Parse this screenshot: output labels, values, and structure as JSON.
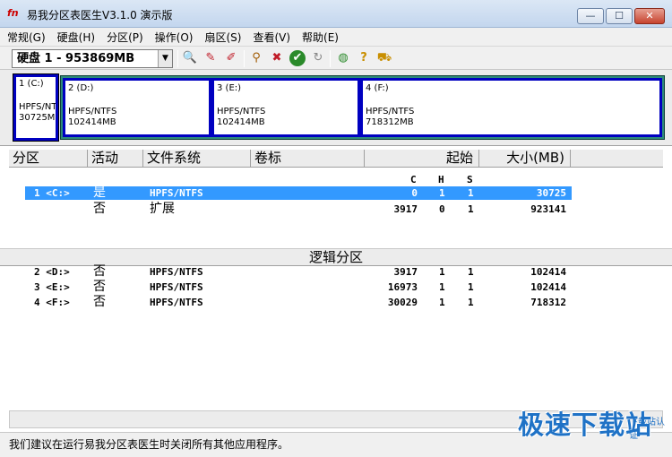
{
  "window": {
    "title": "易我分区表医生V3.1.0 演示版",
    "icon_text": "fn",
    "minimize": "—",
    "maximize": "☐",
    "close": "✕"
  },
  "menu": [
    "常规(G)",
    "硬盘(H)",
    "分区(P)",
    "操作(O)",
    "扇区(S)",
    "查看(V)",
    "帮助(E)"
  ],
  "toolbar": {
    "disk_select": "硬盘 1 - 953869MB",
    "icons": [
      "search-disk-icon",
      "write-icon",
      "write-alt-icon",
      "wand-icon",
      "clear-icon",
      "check-icon",
      "refresh-icon",
      "globe-icon",
      "help-icon",
      "cart-icon"
    ]
  },
  "partitions": {
    "c": {
      "label": "1 (C:)",
      "fs": "HPFS/NTF",
      "size": "30725MB"
    },
    "d": {
      "label": "2 (D:)",
      "fs": "HPFS/NTFS",
      "size": "102414MB"
    },
    "e": {
      "label": "3 (E:)",
      "fs": "HPFS/NTFS",
      "size": "102414MB"
    },
    "f": {
      "label": "4 (F:)",
      "fs": "HPFS/NTFS",
      "size": "718312MB"
    }
  },
  "table": {
    "headers": {
      "partition": "分区",
      "active": "活动",
      "filesystem": "文件系统",
      "volume": "卷标",
      "start": "起始",
      "size": "大小(MB)"
    },
    "sub": {
      "c": "C",
      "h": "H",
      "s": "S"
    },
    "primary_rows": [
      {
        "part": "1 <C:>",
        "active": "是",
        "fs": "HPFS/NTFS",
        "c": "0",
        "h": "1",
        "s": "1",
        "size": "30725"
      },
      {
        "part": "",
        "active": "否",
        "fs": "扩展",
        "c": "3917",
        "h": "0",
        "s": "1",
        "size": "923141"
      }
    ],
    "logical_label": "逻辑分区",
    "logical_rows": [
      {
        "part": "2 <D:>",
        "active": "否",
        "fs": "HPFS/NTFS",
        "c": "3917",
        "h": "1",
        "s": "1",
        "size": "102414"
      },
      {
        "part": "3 <E:>",
        "active": "否",
        "fs": "HPFS/NTFS",
        "c": "16973",
        "h": "1",
        "s": "1",
        "size": "102414"
      },
      {
        "part": "4 <F:>",
        "active": "否",
        "fs": "HPFS/NTFS",
        "c": "30029",
        "h": "1",
        "s": "1",
        "size": "718312"
      }
    ]
  },
  "status": {
    "text": "我们建议在运行易我分区表医生时关闭所有其他应用程序。"
  },
  "watermark": {
    "main": "极速下载站",
    "sub": "下载站认证"
  },
  "colors": {
    "selection": "#3399ff",
    "partition_border": "#0000c0",
    "extended": "#2e8b7a",
    "watermark": "#1f72c6"
  }
}
